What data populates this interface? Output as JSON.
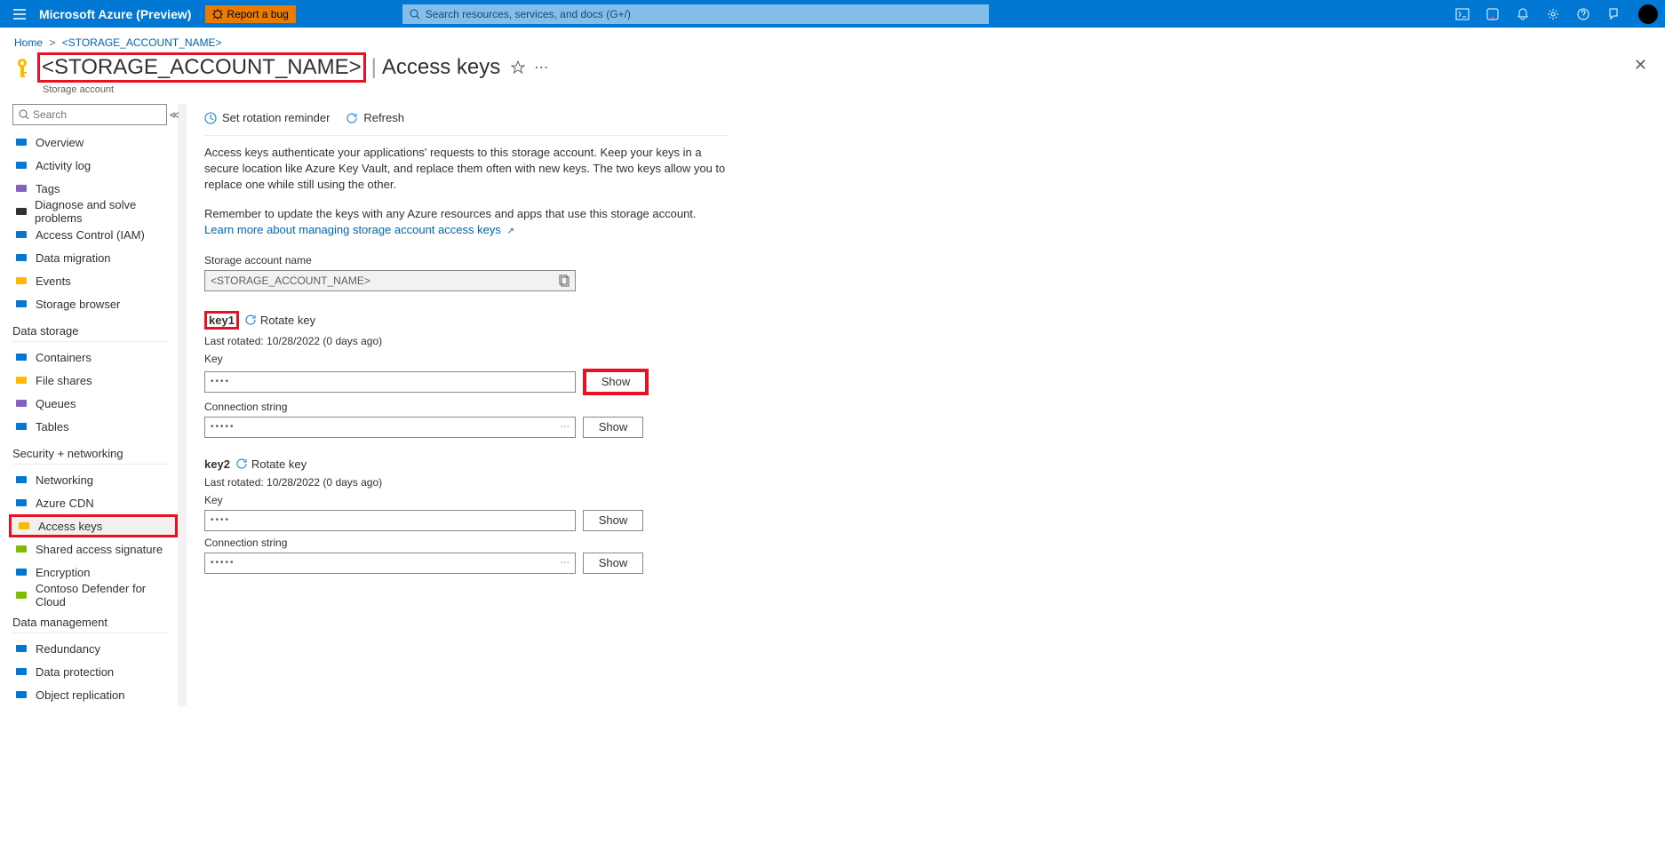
{
  "topbar": {
    "brand": "Microsoft Azure (Preview)",
    "bug_label": "Report a bug",
    "search_placeholder": "Search resources, services, and docs (G+/)"
  },
  "breadcrumb": {
    "home": "Home",
    "current": "<STORAGE_ACCOUNT_NAME>"
  },
  "header": {
    "title": "<STORAGE_ACCOUNT_NAME>",
    "subtitle_page": "Access keys",
    "resource_type": "Storage account"
  },
  "sidebar": {
    "search_placeholder": "Search",
    "items_top": [
      {
        "icon": "overview-icon",
        "label": "Overview",
        "color": "#0078d4"
      },
      {
        "icon": "activity-log-icon",
        "label": "Activity log",
        "color": "#0078d4"
      },
      {
        "icon": "tags-icon",
        "label": "Tags",
        "color": "#8661c5"
      },
      {
        "icon": "diagnose-icon",
        "label": "Diagnose and solve problems",
        "color": "#323130"
      },
      {
        "icon": "access-control-icon",
        "label": "Access Control (IAM)",
        "color": "#0078d4"
      },
      {
        "icon": "data-migration-icon",
        "label": "Data migration",
        "color": "#0078d4"
      },
      {
        "icon": "events-icon",
        "label": "Events",
        "color": "#ffb900"
      },
      {
        "icon": "storage-browser-icon",
        "label": "Storage browser",
        "color": "#0078d4"
      }
    ],
    "section_data_storage": "Data storage",
    "items_data_storage": [
      {
        "icon": "containers-icon",
        "label": "Containers",
        "color": "#0078d4"
      },
      {
        "icon": "file-shares-icon",
        "label": "File shares",
        "color": "#ffb900"
      },
      {
        "icon": "queues-icon",
        "label": "Queues",
        "color": "#8661c5"
      },
      {
        "icon": "tables-icon",
        "label": "Tables",
        "color": "#0078d4"
      }
    ],
    "section_security": "Security + networking",
    "items_security": [
      {
        "icon": "networking-icon",
        "label": "Networking",
        "color": "#0078d4"
      },
      {
        "icon": "azure-cdn-icon",
        "label": "Azure CDN",
        "color": "#0078d4"
      },
      {
        "icon": "access-keys-icon",
        "label": "Access keys",
        "color": "#ffb900",
        "highlight": true
      },
      {
        "icon": "sas-icon",
        "label": "Shared access signature",
        "color": "#7fbc00"
      },
      {
        "icon": "encryption-icon",
        "label": "Encryption",
        "color": "#0078d4"
      },
      {
        "icon": "defender-icon",
        "label": "Contoso Defender for Cloud",
        "color": "#7fbc00"
      }
    ],
    "section_data_mgmt": "Data management",
    "items_data_mgmt": [
      {
        "icon": "redundancy-icon",
        "label": "Redundancy",
        "color": "#0078d4"
      },
      {
        "icon": "data-protection-icon",
        "label": "Data protection",
        "color": "#0078d4"
      },
      {
        "icon": "object-replication-icon",
        "label": "Object replication",
        "color": "#0078d4"
      }
    ]
  },
  "toolbar": {
    "set_rotation": "Set rotation reminder",
    "refresh": "Refresh"
  },
  "info": {
    "p1": "Access keys authenticate your applications' requests to this storage account. Keep your keys in a secure location like Azure Key Vault, and replace them often with new keys. The two keys allow you to replace one while still using the other.",
    "p2": "Remember to update the keys with any Azure resources and apps that use this storage account.",
    "link": "Learn more about managing storage account access keys"
  },
  "storage_account": {
    "label": "Storage account name",
    "value": "<STORAGE_ACCOUNT_NAME>"
  },
  "keys": {
    "rotate_label": "Rotate key",
    "key_label": "Key",
    "conn_label": "Connection string",
    "show_label": "Show",
    "masked4": "••••",
    "masked5": "•••••",
    "key1": {
      "name": "key1",
      "last_rotated": "Last rotated: 10/28/2022 (0 days ago)"
    },
    "key2": {
      "name": "key2",
      "last_rotated": "Last rotated: 10/28/2022 (0 days ago)"
    }
  }
}
